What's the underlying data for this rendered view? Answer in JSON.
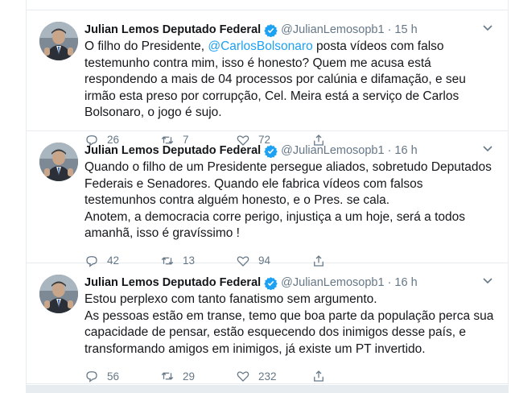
{
  "tweets": [
    {
      "name": "Julian Lemos Deputado Federal",
      "handle": "@JulianLemosopb1",
      "dot": "·",
      "time": "15 h",
      "text_before": "O filho do Presidente, ",
      "mention": "@CarlosBolsonaro",
      "text_after": " posta vídeos com falso testemunho contra mim, isso é honesto? Quem me acusa está respondendo a mais de 04 processos por calúnia e difamação, e seu irmão esta preso por corrupção, Cel. Meira está a serviço de Carlos Bolsonaro, o jogo é sujo.",
      "replies": "26",
      "retweets": "7",
      "likes": "72"
    },
    {
      "name": "Julian Lemos Deputado Federal",
      "handle": "@JulianLemosopb1",
      "dot": "·",
      "time": "16 h",
      "text": "Quando o filho de um Presidente persegue aliados, sobretudo Deputados Federais e Senadores. Quando ele fabrica vídeos com falsos testemunhos contra alguém honesto, e o Pres. se cala.\nAnotem, a democracia corre perigo, injustiça a um hoje, será a todos amanhã, isso é gravíssimo !",
      "replies": "42",
      "retweets": "13",
      "likes": "94"
    },
    {
      "name": "Julian Lemos Deputado Federal",
      "handle": "@JulianLemosopb1",
      "dot": "·",
      "time": "16 h",
      "text": "Estou perplexo com tanto fanatismo sem argumento.\nAs pessoas estão em transe, temo que boa parte da população perca sua capacidade de pensar, estão esquecendo dos inimigos desse país, e transformando amigos em inimigos, já existe um PT invertido.",
      "replies": "56",
      "retweets": "29",
      "likes": "232"
    }
  ],
  "colors": {
    "accent": "#1da1f2",
    "muted": "#657786",
    "text": "#14171a",
    "border": "#e6ecf0"
  },
  "icons": [
    "verified-icon",
    "caret-down-icon",
    "reply-icon",
    "retweet-icon",
    "like-icon",
    "share-icon"
  ]
}
